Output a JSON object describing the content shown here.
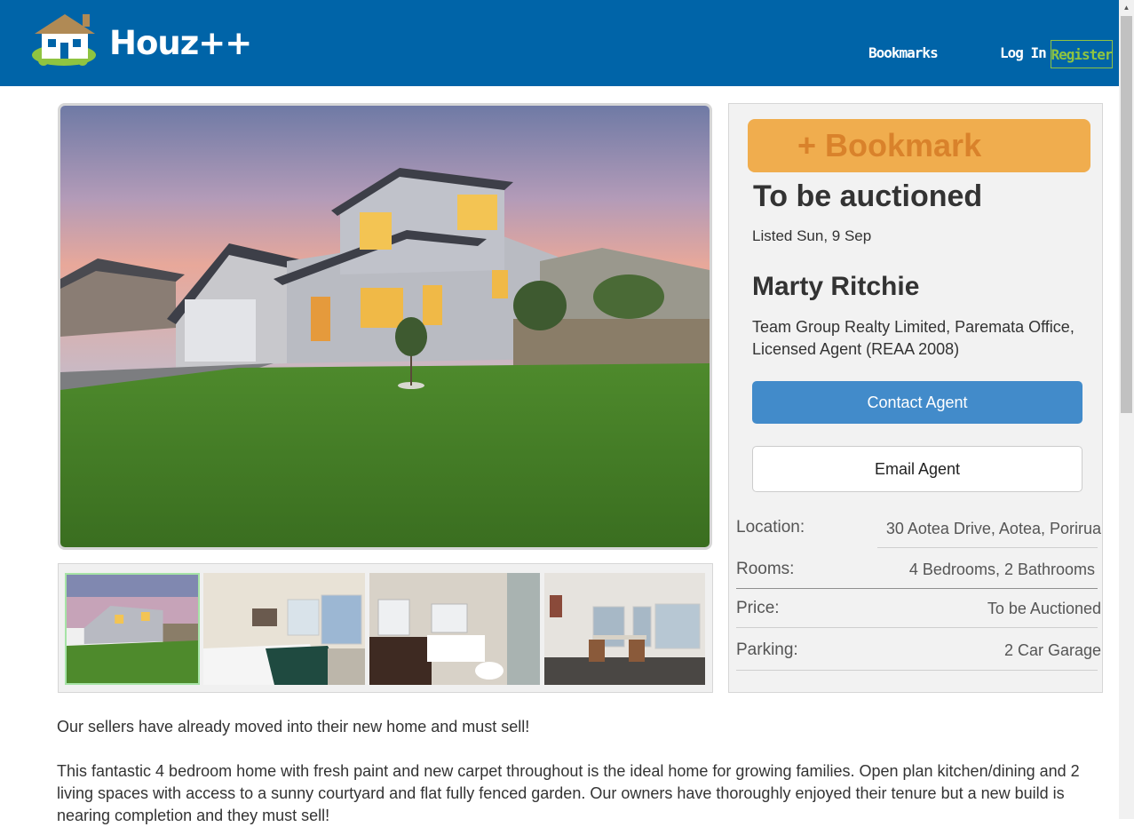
{
  "header": {
    "brand": "Houz++",
    "nav": {
      "bookmarks": "Bookmarks",
      "login": "Log In",
      "register": "Register"
    }
  },
  "listing": {
    "bookmark_label": "+ Bookmark",
    "status": "To be auctioned",
    "listed": "Listed Sun, 9 Sep",
    "agent": {
      "name": "Marty Ritchie",
      "agency": "Team Group Realty Limited, Paremata Office, Licensed Agent (REAA 2008)",
      "contact_label": "Contact Agent",
      "email_label": "Email Agent"
    },
    "details": [
      {
        "label": "Location:",
        "value": "30 Aotea Drive, Aotea, Porirua"
      },
      {
        "label": "Rooms:",
        "value": "4 Bedrooms, 2 Bathrooms"
      },
      {
        "label": "Price:",
        "value": "To be Auctioned"
      },
      {
        "label": "Parking:",
        "value": "2 Car Garage"
      }
    ],
    "description": [
      "Our sellers have already moved into their new home and must sell!",
      "This fantastic 4 bedroom home with fresh paint and new carpet throughout is the ideal home for growing families. Open plan kitchen/dining and 2 living spaces with access to a sunny courtyard and flat fully fenced garden. Our owners have thoroughly enjoyed their tenure but a new build is nearing completion and they must sell!"
    ]
  },
  "colors": {
    "header_bg": "#0064a8",
    "register_accent": "#8fc441",
    "bookmark_bg": "#f0ad4e",
    "contact_bg": "#428bca"
  }
}
